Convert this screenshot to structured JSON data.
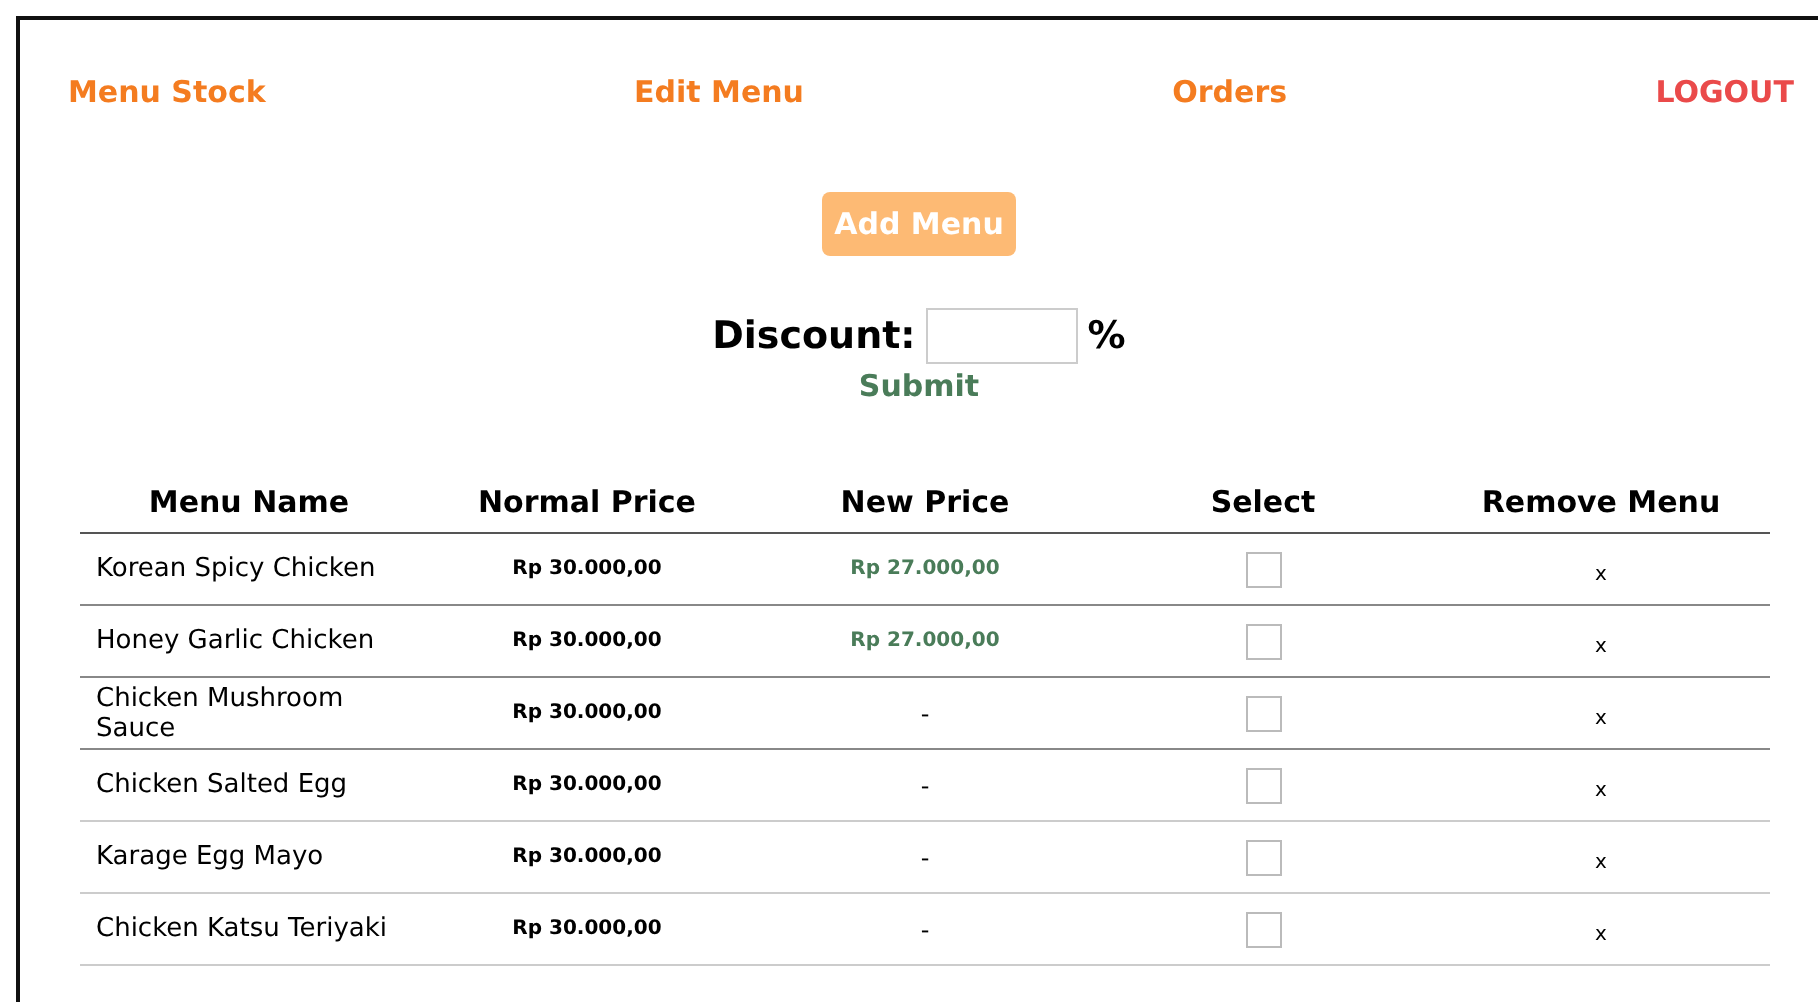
{
  "nav": [
    {
      "label": "Menu Stock",
      "kind": "link"
    },
    {
      "label": "Edit Menu",
      "kind": "link"
    },
    {
      "label": "Orders",
      "kind": "link"
    },
    {
      "label": "LOGOUT",
      "kind": "logout"
    }
  ],
  "add_button": "Add Menu",
  "discount": {
    "label": "Discount:",
    "unit": "%",
    "submit": "Submit"
  },
  "table": {
    "columns": [
      "Menu Name",
      "Normal Price",
      "New Price",
      "Select",
      "Remove Menu"
    ],
    "rows": [
      {
        "name": "Korean Spicy Chicken",
        "normal_price": "Rp 30.000,00",
        "new_price": "Rp 27.000,00",
        "discounted": true,
        "checked": false,
        "remove": "x"
      },
      {
        "name": "Honey Garlic Chicken",
        "normal_price": "Rp 30.000,00",
        "new_price": "Rp 27.000,00",
        "discounted": true,
        "checked": false,
        "remove": "x"
      },
      {
        "name": "Chicken Mushroom Sauce",
        "normal_price": "Rp 30.000,00",
        "new_price": "-",
        "discounted": false,
        "checked": false,
        "remove": "x"
      },
      {
        "name": "Chicken Salted Egg",
        "normal_price": "Rp 30.000,00",
        "new_price": "-",
        "discounted": false,
        "checked": false,
        "remove": "x"
      },
      {
        "name": "Karage Egg Mayo",
        "normal_price": "Rp 30.000,00",
        "new_price": "-",
        "discounted": false,
        "checked": false,
        "remove": "x"
      },
      {
        "name": "Chicken Katsu Teriyaki",
        "normal_price": "Rp 30.000,00",
        "new_price": "-",
        "discounted": false,
        "checked": false,
        "remove": "x"
      }
    ]
  }
}
